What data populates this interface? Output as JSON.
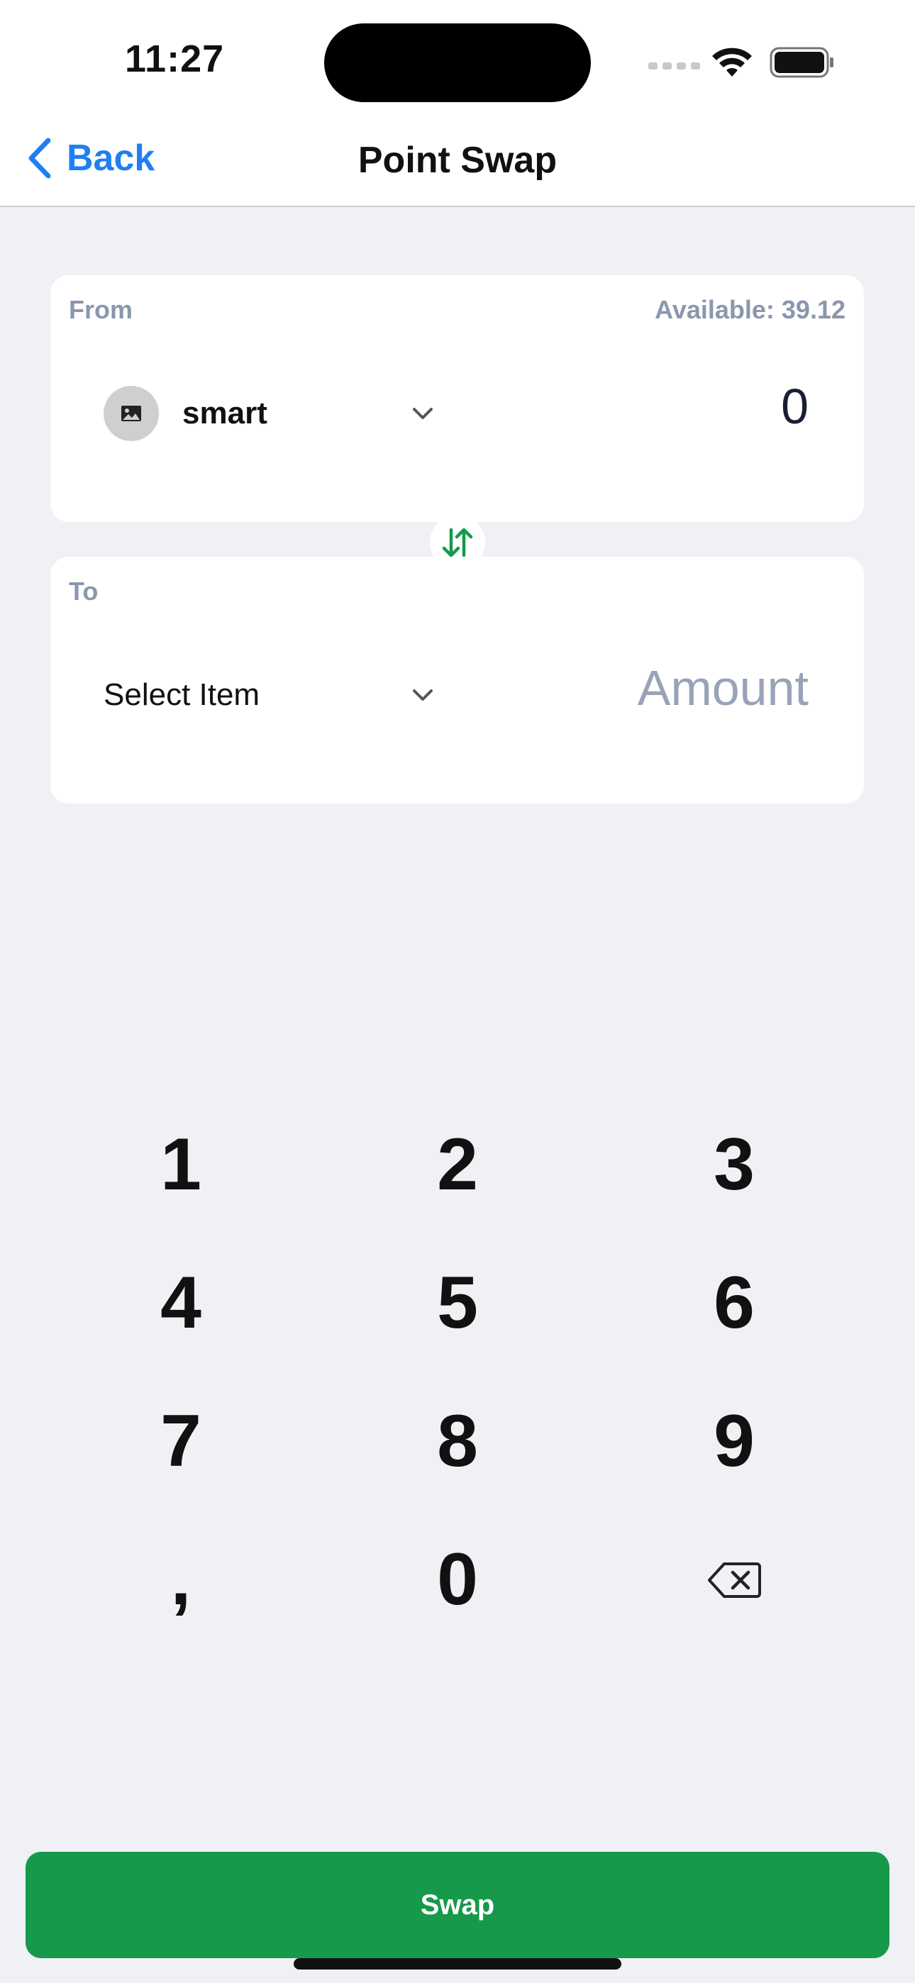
{
  "status_bar": {
    "time": "11:27"
  },
  "nav": {
    "back_label": "Back",
    "title": "Point Swap"
  },
  "from_card": {
    "label": "From",
    "available": "Available: 39.12",
    "token_name": "smart",
    "token_icon": "image-placeholder-icon",
    "amount": "0"
  },
  "to_card": {
    "label": "To",
    "select_text": "Select Item",
    "amount_placeholder": "Amount"
  },
  "keypad": {
    "k1": "1",
    "k2": "2",
    "k3": "3",
    "k4": "4",
    "k5": "5",
    "k6": "6",
    "k7": "7",
    "k8": "8",
    "k9": "9",
    "comma": ",",
    "k0": "0",
    "delete_icon": "backspace-icon"
  },
  "cta": {
    "label": "Swap"
  },
  "colors": {
    "accent": "#1f7ff0",
    "primary_button": "#16994b",
    "background": "#f0f1f5",
    "muted_label": "#8a97ad"
  }
}
